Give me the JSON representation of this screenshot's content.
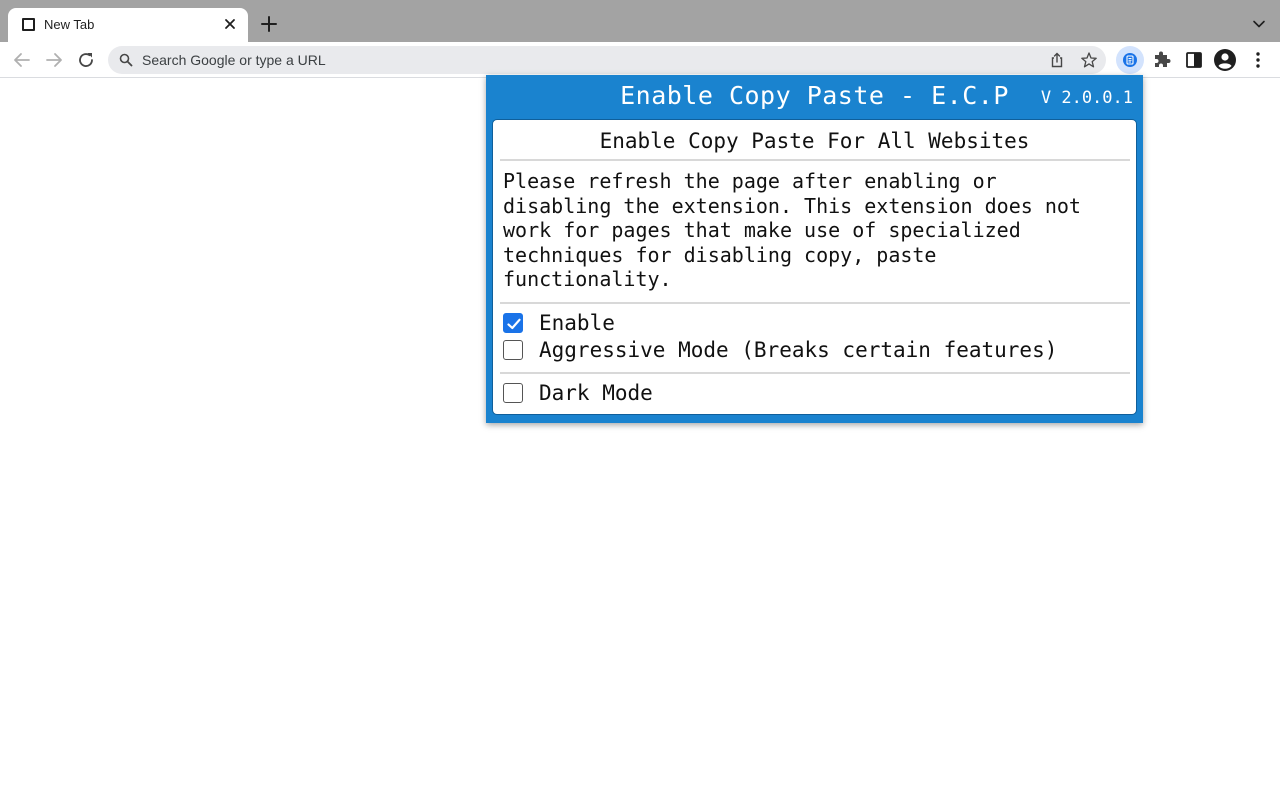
{
  "browser": {
    "tab": {
      "title": "New Tab"
    },
    "omnibox": {
      "placeholder": "Search Google or type a URL",
      "value": ""
    },
    "icons": [
      "back-icon",
      "forward-icon",
      "reload-icon",
      "search-icon",
      "share-icon",
      "bookmark-star-icon",
      "extension-icon",
      "puzzle-icon",
      "side-panel-icon",
      "profile-icon",
      "menu-icon"
    ]
  },
  "popup": {
    "title": "Enable Copy Paste - E.C.P",
    "version": "V 2.0.0.1",
    "heading": "Enable Copy Paste For All Websites",
    "description": "Please refresh the page after enabling or\ndisabling the extension. This extension does not\nwork for pages that make use of specialized\ntechniques for disabling copy, paste\nfunctionality.",
    "options": [
      {
        "label": "Enable",
        "checked": true
      },
      {
        "label": "Aggressive Mode (Breaks certain features)",
        "checked": false
      },
      {
        "label": "Dark Mode",
        "checked": false
      }
    ],
    "colors": {
      "header_bg": "#1a83cf",
      "checkbox_accent": "#1a73e8"
    }
  }
}
